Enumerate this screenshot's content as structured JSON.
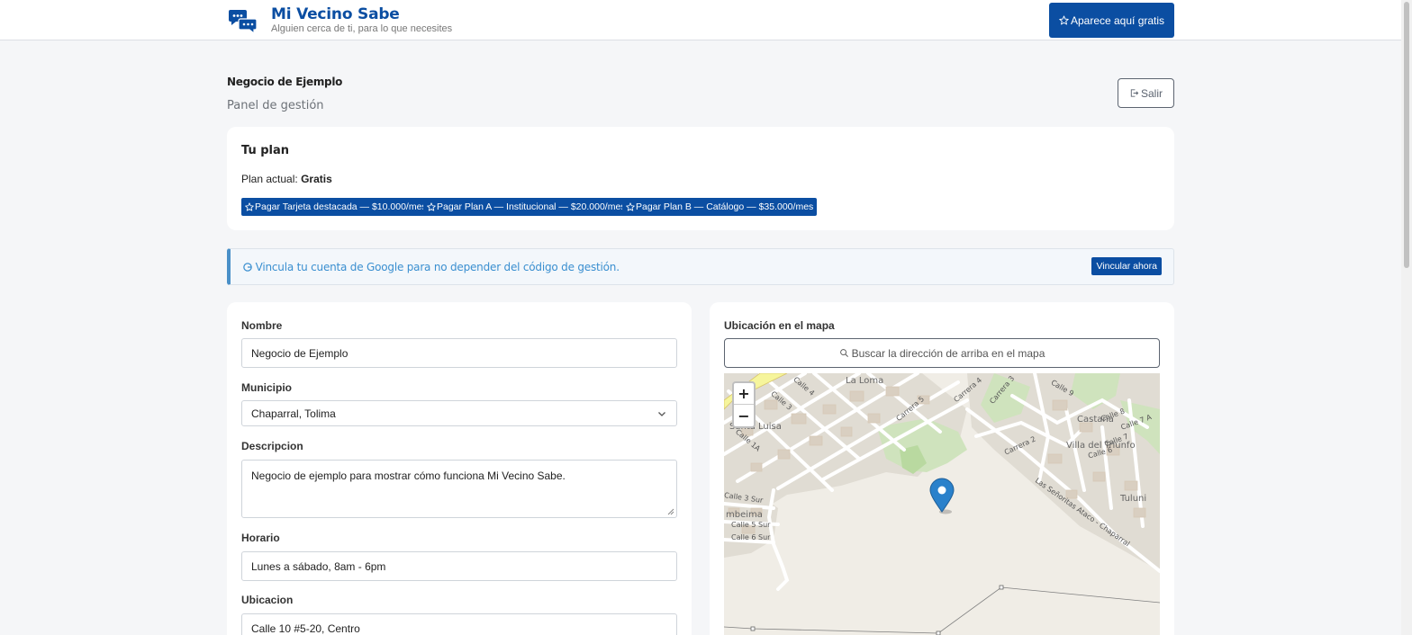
{
  "header": {
    "brand_title": "Mi Vecino Sabe",
    "brand_subtitle": "Alguien cerca de ti, para lo que necesites",
    "cta_label": "Aparece aquí gratis",
    "logo_icon": "chat-bubbles-icon",
    "brand_color": "#0b4ea2"
  },
  "page": {
    "business_name": "Negocio de Ejemplo",
    "panel_title": "Panel de gestión",
    "exit_label": "Salir"
  },
  "plan": {
    "title": "Tu plan",
    "current_prefix": "Plan actual:",
    "current_value": "Gratis",
    "buttons": [
      {
        "label": "Pagar Tarjeta destacada — $10.000/mes"
      },
      {
        "label": "Pagar Plan A — Institucional — $20.000/mes"
      },
      {
        "label": "Pagar Plan B — Catálogo — $35.000/mes"
      }
    ]
  },
  "alert": {
    "text": "Vincula tu cuenta de Google para no depender del código de gestión.",
    "button": "Vincular ahora",
    "icon": "google-icon",
    "color": "#3a8fd0"
  },
  "form": {
    "name_label": "Nombre",
    "name_value": "Negocio de Ejemplo",
    "municipio_label": "Municipio",
    "municipio_value": "Chaparral, Tolima",
    "descripcion_label": "Descripcion",
    "descripcion_value": "Negocio de ejemplo para mostrar cómo funciona Mi Vecino Sabe.",
    "horario_label": "Horario",
    "horario_value": "Lunes a sábado, 8am - 6pm",
    "ubicacion_label": "Ubicacion",
    "ubicacion_value": "Calle 10 #5-20, Centro"
  },
  "map": {
    "title": "Ubicación en el mapa",
    "search_label": "Buscar la dirección de arriba en el mapa",
    "zoom_in": "+",
    "zoom_out": "−",
    "labels": {
      "la_loma": "La Loma",
      "santa_luisa": "Santa Luisa",
      "castana": "Castaña",
      "villa_triunfo": "Villa del Triunfo",
      "tuluni": "Tuluni",
      "ambeima": "mbeima",
      "calle4": "Calle 4",
      "calle3": "Calle 3",
      "calle1a": "Calle 1A",
      "carrera5": "Carrera 5",
      "carrera4": "Carrera 4",
      "carrera3": "Carrera 3",
      "carrera2": "Carrera 2",
      "calle9": "Calle 9",
      "calle8": "Calle 8",
      "calle7a": "Calle 7 A",
      "calle7": "Calle 7",
      "calle6": "Calle 6",
      "calle3sur": "Calle 3 Sur",
      "calle5sur": "Calle 5 Sur",
      "calle6sur": "Calle 6 Sur",
      "via": "Las Señoritas Ataco - Chaparral"
    }
  }
}
